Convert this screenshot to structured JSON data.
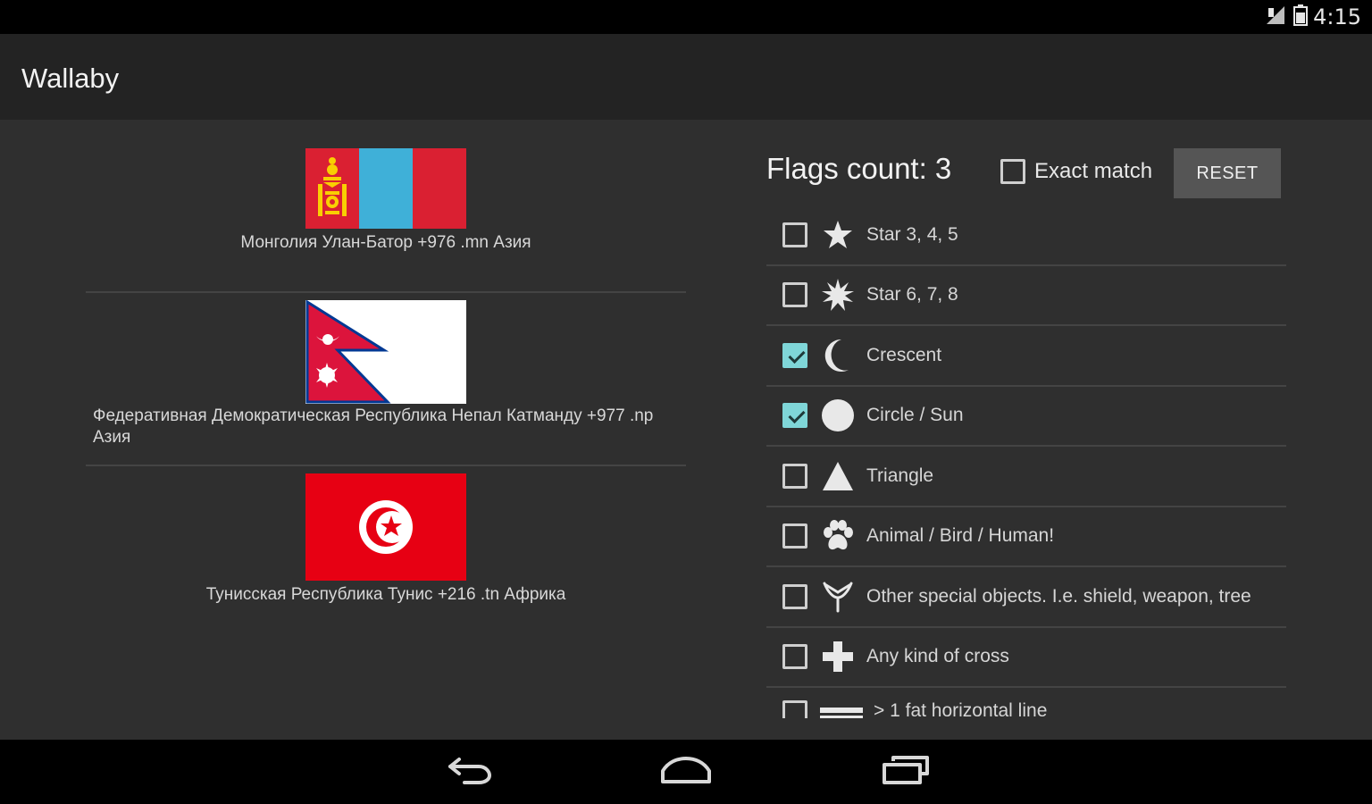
{
  "status_bar": {
    "time": "4:15"
  },
  "app": {
    "title": "Wallaby"
  },
  "flags": [
    {
      "caption": "Монголия Улан-Батор +976 .mn Азия"
    },
    {
      "caption": "Федеративная Демократическая Республика Непал Катманду +977 .np Азия"
    },
    {
      "caption": "Тунисская Республика Тунис +216 .tn Африка"
    }
  ],
  "filters_header": {
    "flags_count": "Flags count: 3",
    "exact_match_label": "Exact match",
    "exact_match_checked": false,
    "reset_label": "RESET"
  },
  "filters": [
    {
      "label": "Star 3, 4, 5",
      "icon": "star-icon",
      "checked": false
    },
    {
      "label": "Star 6, 7, 8",
      "icon": "sunburst-star-icon",
      "checked": false
    },
    {
      "label": "Crescent",
      "icon": "crescent-icon",
      "checked": true
    },
    {
      "label": "Circle / Sun",
      "icon": "circle-icon",
      "checked": true
    },
    {
      "label": "Triangle",
      "icon": "triangle-icon",
      "checked": false
    },
    {
      "label": "Animal / Bird / Human!",
      "icon": "paw-icon",
      "checked": false
    },
    {
      "label": "Other special objects. I.e. shield, weapon, tree",
      "icon": "slingshot-icon",
      "checked": false
    },
    {
      "label": "Any kind of cross",
      "icon": "cross-icon",
      "checked": false
    },
    {
      "label": "> 1 fat horizontal line",
      "icon": "horizontal-lines-icon",
      "checked": false
    }
  ],
  "colors": {
    "accent_check": "#7fd6d8",
    "mongolia_red": "#da2032",
    "mongolia_blue": "#3fb0d8",
    "mongolia_gold": "#f9cf02",
    "nepal_crimson": "#dc143c",
    "nepal_blue": "#003893",
    "tunisia_red": "#e70013"
  }
}
